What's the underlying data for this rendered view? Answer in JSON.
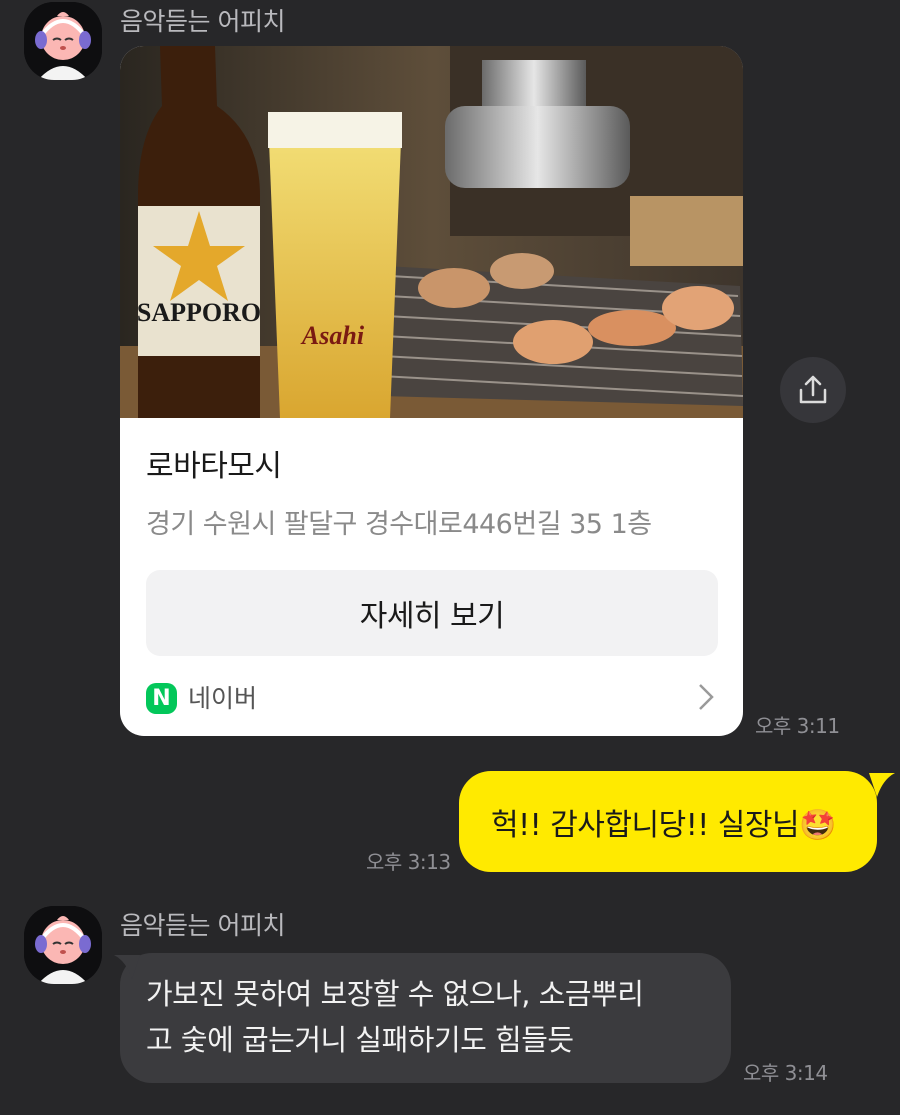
{
  "messages": [
    {
      "sender": "음악듣는 어피치",
      "type": "link_card",
      "card": {
        "title": "로바타모시",
        "address": "경기 수원시 팔달구 경수대로446번길 35 1층",
        "button_label": "자세히 보기",
        "source_logo": "N",
        "source_label": "네이버"
      },
      "time": "오후 3:11"
    },
    {
      "sender": "me",
      "type": "text",
      "text": "헉!! 감사합니당!! 실장님🤩",
      "time": "오후 3:13"
    },
    {
      "sender": "음악듣는 어피치",
      "type": "text",
      "lines": [
        "가보진 못하여 보장할 수 없으나, 소금뿌리",
        "고 숯에 굽는거니 실패하기도 힘들듯"
      ],
      "time": "오후 3:14"
    }
  ],
  "icons": {
    "avatar": "apeach-headphones-avatar",
    "share": "share-upload-icon",
    "chevron": "chevron-right-icon"
  },
  "photo": {
    "bottle_label": "SAPPORO",
    "glass_label": "Asahi"
  },
  "colors": {
    "background": "#272729",
    "my_bubble": "#ffea00",
    "their_bubble": "#3b3b3e",
    "naver_green": "#03c75a"
  }
}
